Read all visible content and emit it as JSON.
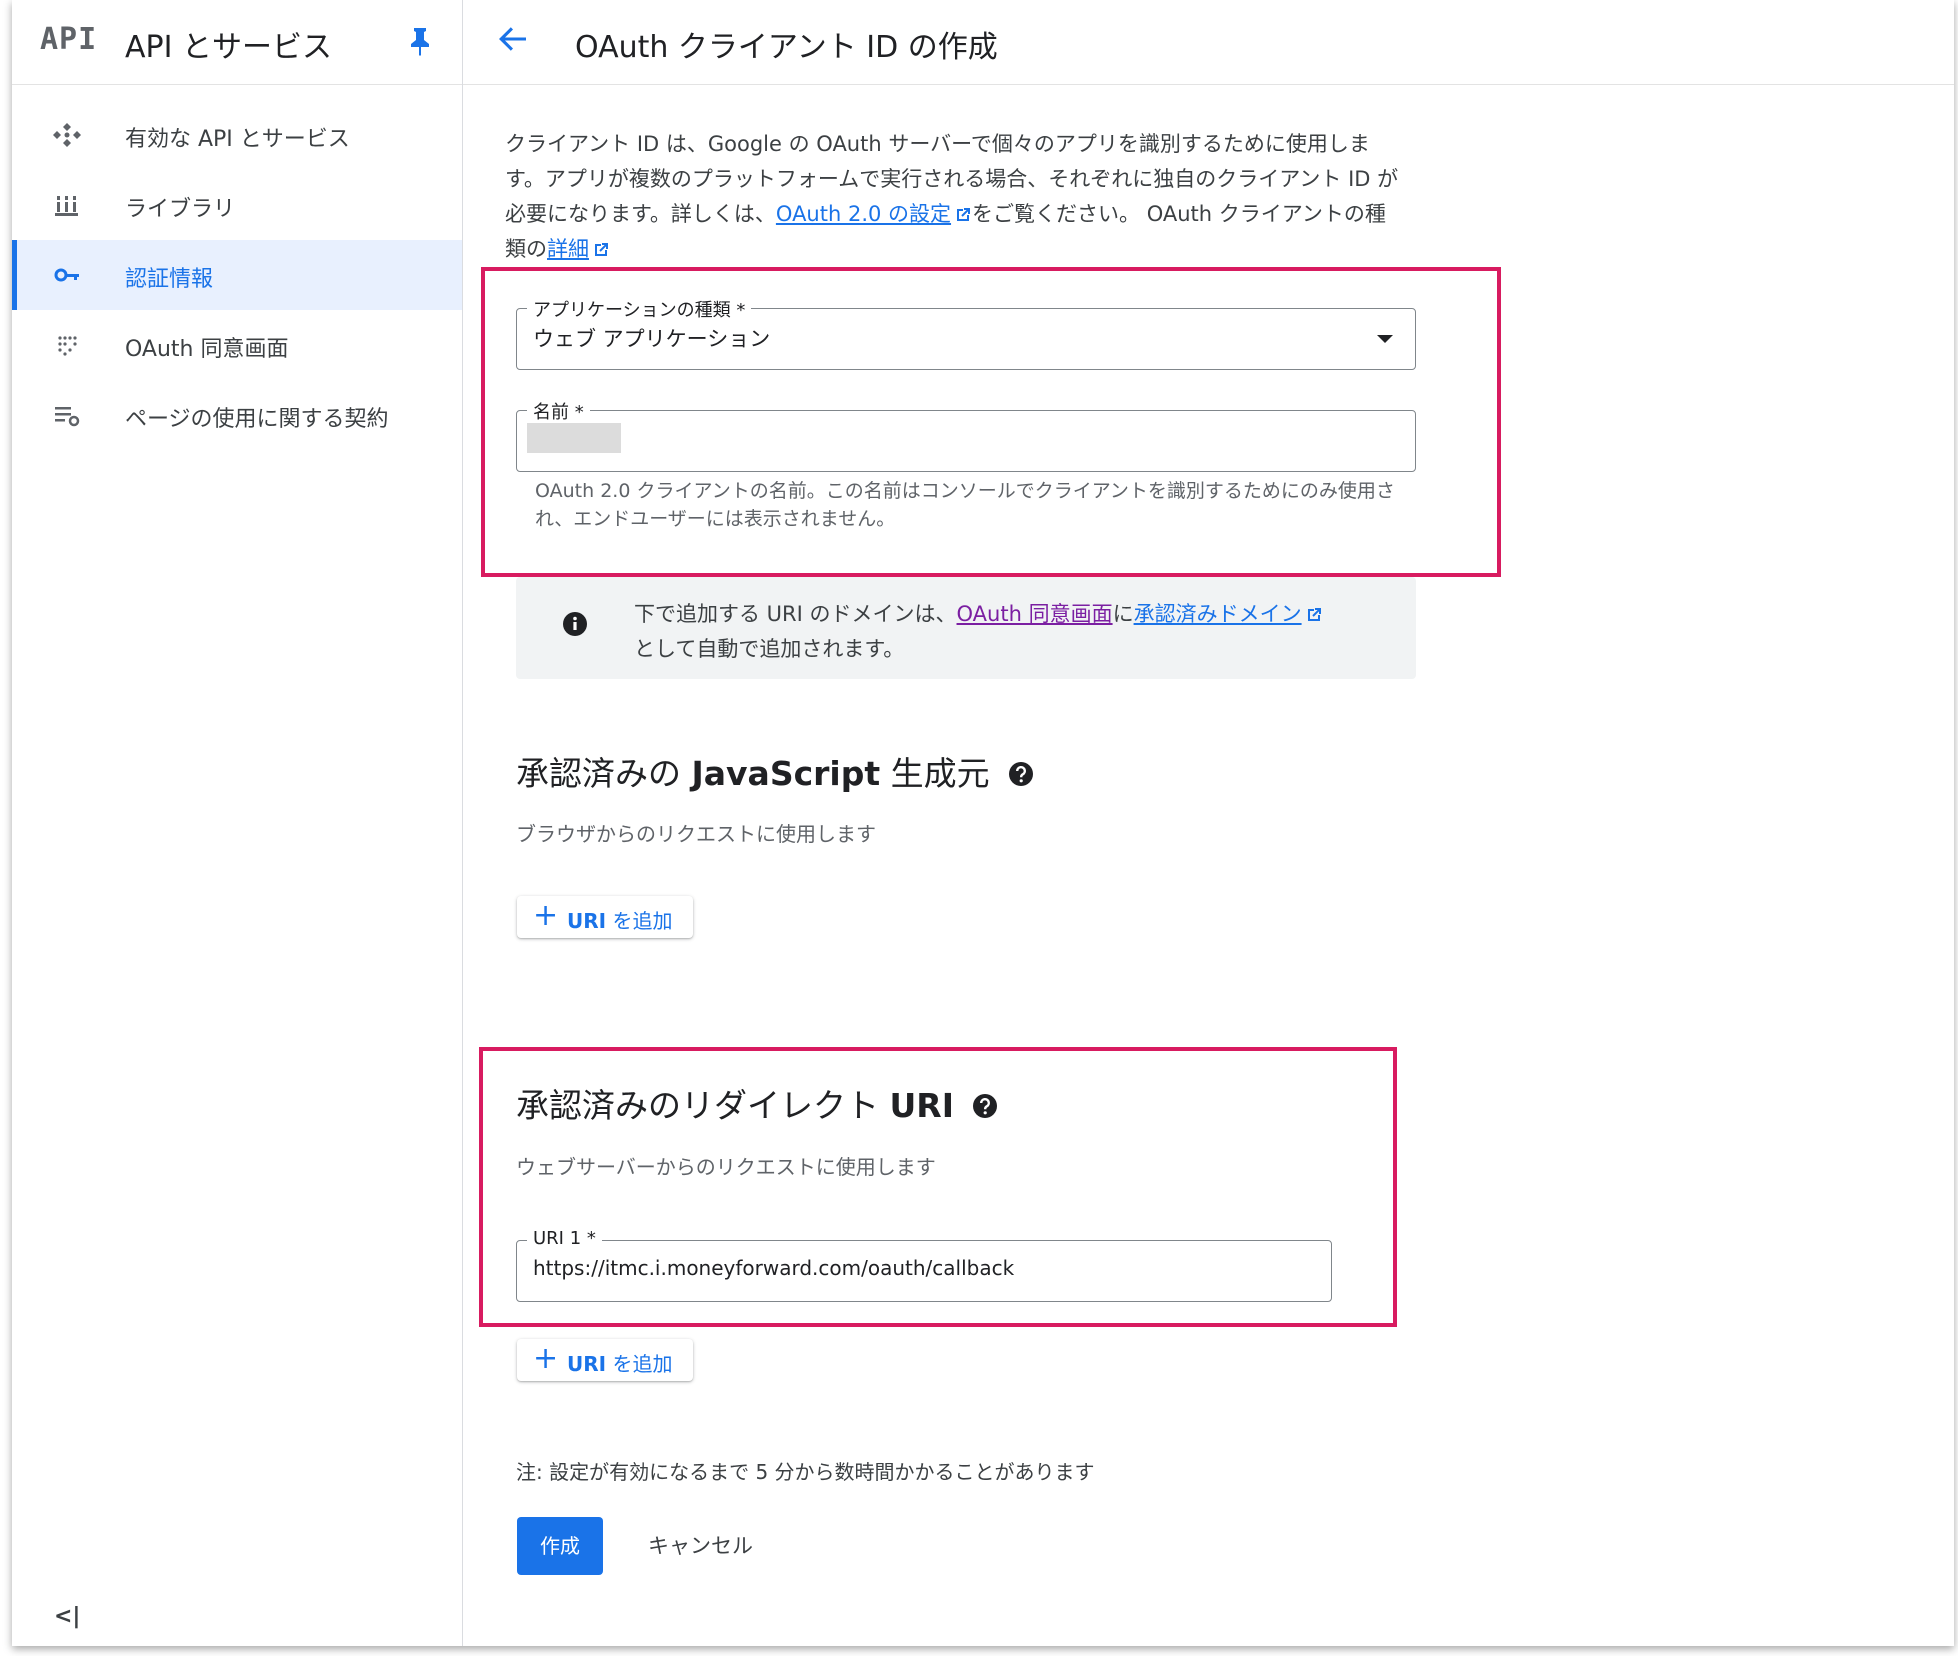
{
  "sidebar": {
    "logo": "API",
    "title": "API とサービス",
    "items": [
      {
        "label": "有効な API とサービス",
        "icon": "api-hub-icon"
      },
      {
        "label": "ライブラリ",
        "icon": "library-icon"
      },
      {
        "label": "認証情報",
        "icon": "key-icon",
        "active": true
      },
      {
        "label": "OAuth 同意画面",
        "icon": "consent-grid-icon"
      },
      {
        "label": "ページの使用に関する契約",
        "icon": "settings-list-icon"
      }
    ],
    "collapse": "<|"
  },
  "header": {
    "title": "OAuth クライアント ID の作成"
  },
  "intro": {
    "text1": "クライアント ID は、Google の OAuth サーバーで個々のアプリを識別するために使用します。アプリが複数のプラットフォームで実行される場合、それぞれに独自のクライアント ID が必要になります。詳しくは、",
    "link1": "OAuth 2.0 の設定",
    "text2": "をご覧ください。 OAuth クライアントの種類の",
    "link2": "詳細"
  },
  "form": {
    "app_type_label": "アプリケーションの種類 *",
    "app_type_value": "ウェブ アプリケーション",
    "name_label": "名前 *",
    "name_hint": "OAuth 2.0 クライアントの名前。この名前はコンソールでクライアントを識別するためにのみ使用され、エンドユーザーには表示されません。"
  },
  "info": {
    "text1": "下で追加する URI のドメインは、",
    "link1": "OAuth 同意画面",
    "text2": "に",
    "link2": "承認済みドメイン",
    "text3": "として自動で追加されます。"
  },
  "js_origins": {
    "title_pre": "承認済みの ",
    "title_bold": "JavaScript",
    "title_post": " 生成元",
    "subtitle": "ブラウザからのリクエストに使用します",
    "add_button": "URI を追加",
    "add_bold": "URI"
  },
  "redirect": {
    "title_pre": "承認済みのリダイレクト ",
    "title_bold": "URI",
    "subtitle": "ウェブサーバーからのリクエストに使用します",
    "uri_label": "URI 1 *",
    "uri_value": "https://itmc.i.moneyforward.com/oauth/callback",
    "add_button": "URI を追加",
    "add_bold": "URI"
  },
  "footer": {
    "note": "注: 設定が有効になるまで 5 分から数時間かかることがあります",
    "create": "作成",
    "cancel": "キャンセル"
  },
  "colors": {
    "accent": "#1a73e8",
    "highlight": "#d81b60",
    "visited_link": "#7b1fa2"
  }
}
